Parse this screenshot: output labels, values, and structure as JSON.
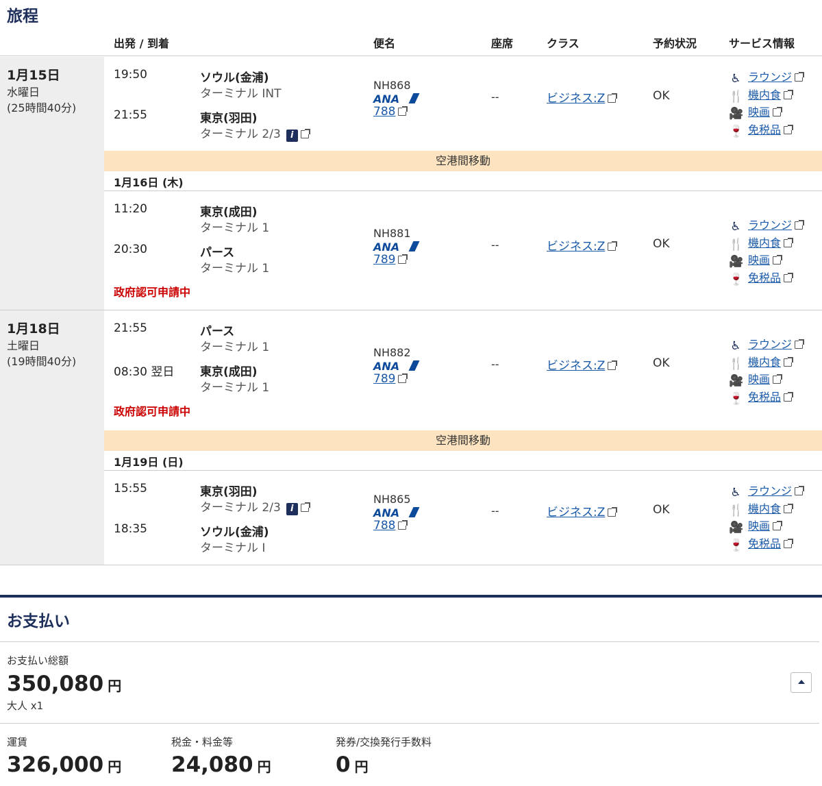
{
  "itinerary": {
    "title": "旅程",
    "headers": {
      "route": "出発 / 到着",
      "flight": "便名",
      "seat": "座席",
      "class": "クラス",
      "status": "予約状況",
      "service": "サービス情報"
    },
    "journeys": [
      {
        "date": "1月15日",
        "dow": "水曜日",
        "duration": "(25時間40分)"
      },
      {
        "date": "1月18日",
        "dow": "土曜日",
        "duration": "(19時間40分)"
      }
    ],
    "segments": [
      {
        "dep_time": "19:50",
        "dep_city": "ソウル(金浦)",
        "dep_terminal": "ターミナル INT",
        "arr_time": "21:55",
        "arr_city": "東京(羽田)",
        "arr_terminal": "ターミナル 2/3",
        "flight": "NH868",
        "airline": "ANA",
        "equipment": "788",
        "seat": "--",
        "class": "ビジネス:Z",
        "status": "OK",
        "warning": ""
      },
      {
        "dep_time": "11:20",
        "dep_city": "東京(成田)",
        "dep_terminal": "ターミナル 1",
        "arr_time": "20:30",
        "arr_city": "パース",
        "arr_terminal": "ターミナル 1",
        "flight": "NH881",
        "airline": "ANA",
        "equipment": "789",
        "seat": "--",
        "class": "ビジネス:Z",
        "status": "OK",
        "warning": "政府認可申請中"
      },
      {
        "dep_time": "21:55",
        "dep_city": "パース",
        "dep_terminal": "ターミナル 1",
        "arr_time": "08:30 翌日",
        "arr_city": "東京(成田)",
        "arr_terminal": "ターミナル 1",
        "flight": "NH882",
        "airline": "ANA",
        "equipment": "789",
        "seat": "--",
        "class": "ビジネス:Z",
        "status": "OK",
        "warning": "政府認可申請中"
      },
      {
        "dep_time": "15:55",
        "dep_city": "東京(羽田)",
        "dep_terminal": "ターミナル 2/3",
        "arr_time": "18:35",
        "arr_city": "ソウル(金浦)",
        "arr_terminal": "ターミナル I",
        "flight": "NH865",
        "airline": "ANA",
        "equipment": "788",
        "seat": "--",
        "class": "ビジネス:Z",
        "status": "OK",
        "warning": ""
      }
    ],
    "transfers": [
      {
        "label": "空港間移動",
        "next_date": "1月16日 (木)"
      },
      {
        "label": "空港間移動",
        "next_date": "1月19日 (日)"
      }
    ],
    "services": {
      "lounge": "ラウンジ",
      "meal": "機内食",
      "movie": "映画",
      "dutyfree": "免税品",
      "icons": [
        "lounge-icon",
        "meal-icon",
        "movie-icon",
        "dutyfree-icon"
      ]
    }
  },
  "payment": {
    "title": "お支払い",
    "total_label": "お支払い総額",
    "total_amount": "350,080",
    "currency": "円",
    "passengers": "大人 x1",
    "fare_label": "運賃",
    "fare_amount": "326,000",
    "tax_label": "税金・料金等",
    "tax_amount": "24,080",
    "fee_label": "発券/交換発行手数料",
    "fee_amount": "0"
  },
  "colors": {
    "navy": "#1d2f5a",
    "link": "#1a5aa8",
    "warning": "#cc0000",
    "transfer_bg": "#fde3bf",
    "date_col_bg": "#eeeeee"
  }
}
